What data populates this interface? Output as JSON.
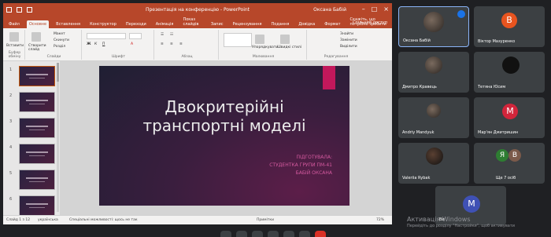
{
  "powerpoint": {
    "window_title": "Презентація на конференцію - PowerPoint",
    "user_name": "Оксана Бабій",
    "tabs": [
      "Файл",
      "Основне",
      "Вставлення",
      "Конструктор",
      "Переходи",
      "Анімація",
      "Показ слайдів",
      "Запис",
      "Рецензування",
      "Подання",
      "Довідка",
      "Формат"
    ],
    "active_tab": "Основне",
    "tell_me": "Скажіть, що потрібно зробити",
    "share_label": "Спільний доступ",
    "ribbon": {
      "paste": "Вставити",
      "clipboard": "Буфер обміну",
      "new_slide": "Створити слайд",
      "layout": "Макет",
      "reset": "Скинути",
      "section": "Розділ",
      "slides_group": "Слайди",
      "font_group": "Шрифт",
      "paragraph_group": "Абзац",
      "arrange": "Упорядкувати",
      "quick_styles": "Швидкі стилі",
      "drawing_group": "Малювання",
      "find": "Знайти",
      "replace": "Замінити",
      "select": "Виділити",
      "editing_group": "Редагування"
    },
    "thumbnails": [
      "1",
      "2",
      "3",
      "4",
      "5",
      "6"
    ],
    "slide": {
      "title_line1": "Двокритерійні",
      "title_line2": "транспортні моделі",
      "sub_line1": "ПІДГОТУВАЛА:",
      "sub_line2": "СТУДЕНТКА ГРУПИ ПМ-41",
      "sub_line3": "БАБІЙ ОКСАНА"
    },
    "status": {
      "slide_counter": "Слайд 1 з 12",
      "language": "українська",
      "accessibility": "Спеціальні можливості: щось не так",
      "notes": "Примітки",
      "zoom": "72%"
    }
  },
  "participants": [
    {
      "name": "Оксана Бабій",
      "initial": "",
      "color": "",
      "photo": true
    },
    {
      "name": "Віктор Мазуренко",
      "initial": "В",
      "color": "#e8541f",
      "photo": false
    },
    {
      "name": "Дмитро Кравець",
      "initial": "",
      "color": "",
      "photo": true
    },
    {
      "name": "Тетяна Юсим",
      "initial": "",
      "color": "",
      "photo": true
    },
    {
      "name": "Andriy Mandyuk",
      "initial": "",
      "color": "",
      "photo": true
    },
    {
      "name": "Мар'ян Дмитришин",
      "initial": "М",
      "color": "#d2253b",
      "photo": false
    },
    {
      "name": "Valeriia Rybak",
      "initial": "",
      "color": "",
      "photo": true
    },
    {
      "name": "Ще 7 осіб",
      "initial": "Я",
      "initial2": "В",
      "color": "#2e7d32",
      "color2": "#7b5a4a",
      "photo": false
    },
    {
      "name": "Ви",
      "initial": "M",
      "color": "#3f51b5",
      "photo": false
    }
  ],
  "watermark": {
    "line1": "Активація Windows",
    "line2": "Перейдіть до розділу \"Настройки\", щоб активувати"
  },
  "colors": {
    "ppt_accent": "#b7472a",
    "slide_accent": "#c2185b",
    "meet_bg": "#1f2023",
    "tile_bg": "#3c4043"
  }
}
